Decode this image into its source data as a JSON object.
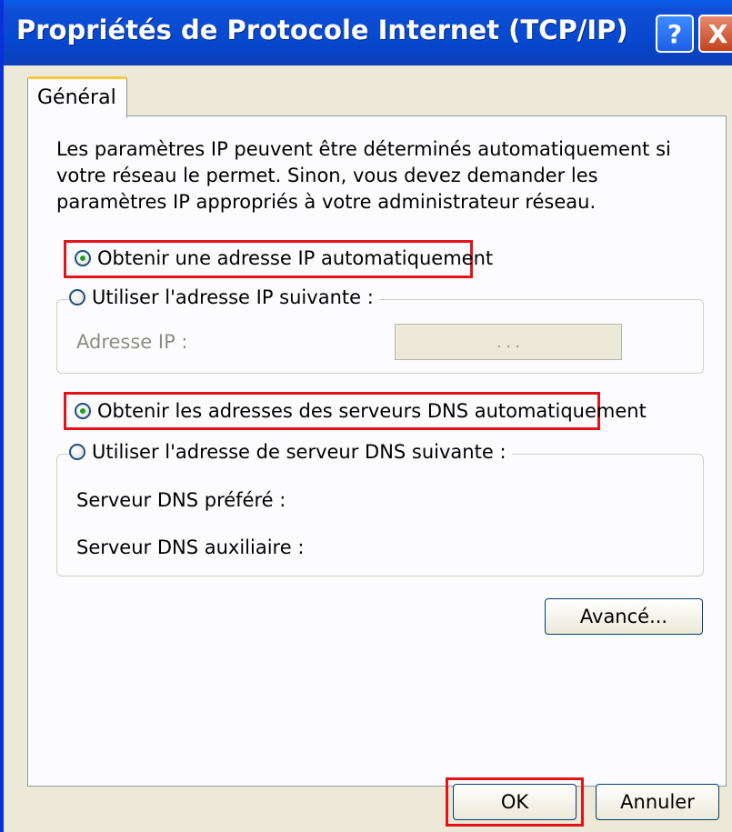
{
  "window": {
    "title": "Propriétés de Protocole Internet (TCP/IP)",
    "help_label": "?",
    "close_label": "X"
  },
  "tabs": [
    {
      "label": "Général",
      "selected": true
    }
  ],
  "description": "Les paramètres IP peuvent être déterminés automatiquement si votre réseau le permet. Sinon, vous devez demander les paramètres IP appropriés à votre administrateur réseau.",
  "ip": {
    "auto_label": "Obtenir une adresse IP automatiquement",
    "manual_label": "Utiliser l'adresse IP suivante :",
    "address_label": "Adresse IP :",
    "address_value": ". . .",
    "mode": "auto"
  },
  "dns": {
    "auto_label": "Obtenir les adresses des serveurs DNS automatiquement",
    "manual_label": "Utiliser l'adresse de serveur DNS suivante :",
    "preferred_label": "Serveur DNS préféré :",
    "alternate_label": "Serveur DNS auxiliaire :",
    "mode": "auto"
  },
  "buttons": {
    "advanced": "Avancé...",
    "ok": "OK",
    "cancel": "Annuler"
  },
  "colors": {
    "titlebar": "#0648cf",
    "highlight": "#e2141a",
    "radio_dot": "#21a121"
  }
}
